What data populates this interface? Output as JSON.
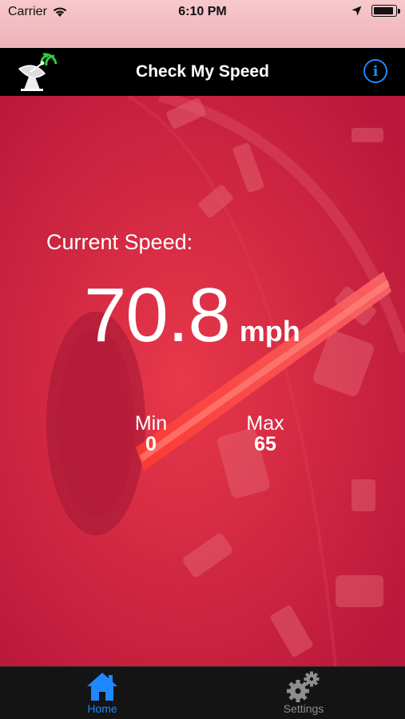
{
  "status_bar": {
    "carrier": "Carrier",
    "time": "6:10 PM",
    "icons": [
      "wifi-icon",
      "location-arrow-icon",
      "battery-icon"
    ]
  },
  "nav": {
    "title": "Check My Speed",
    "logo_icon": "satellite-dish-icon",
    "info_icon": "info-icon",
    "info_label": "i"
  },
  "speed": {
    "label": "Current Speed:",
    "value": "70.8",
    "unit": "mph"
  },
  "stats": {
    "min_label": "Min",
    "min_value": "0",
    "max_label": "Max",
    "max_value": "65"
  },
  "tabs": [
    {
      "label": "Home",
      "icon": "home-icon",
      "selected": true
    },
    {
      "label": "Settings",
      "icon": "gears-icon",
      "selected": false
    }
  ],
  "colors": {
    "accent": "#1e88ff",
    "background": "#c11c3c",
    "bar": "#000000",
    "signal": "#2ecc40"
  }
}
